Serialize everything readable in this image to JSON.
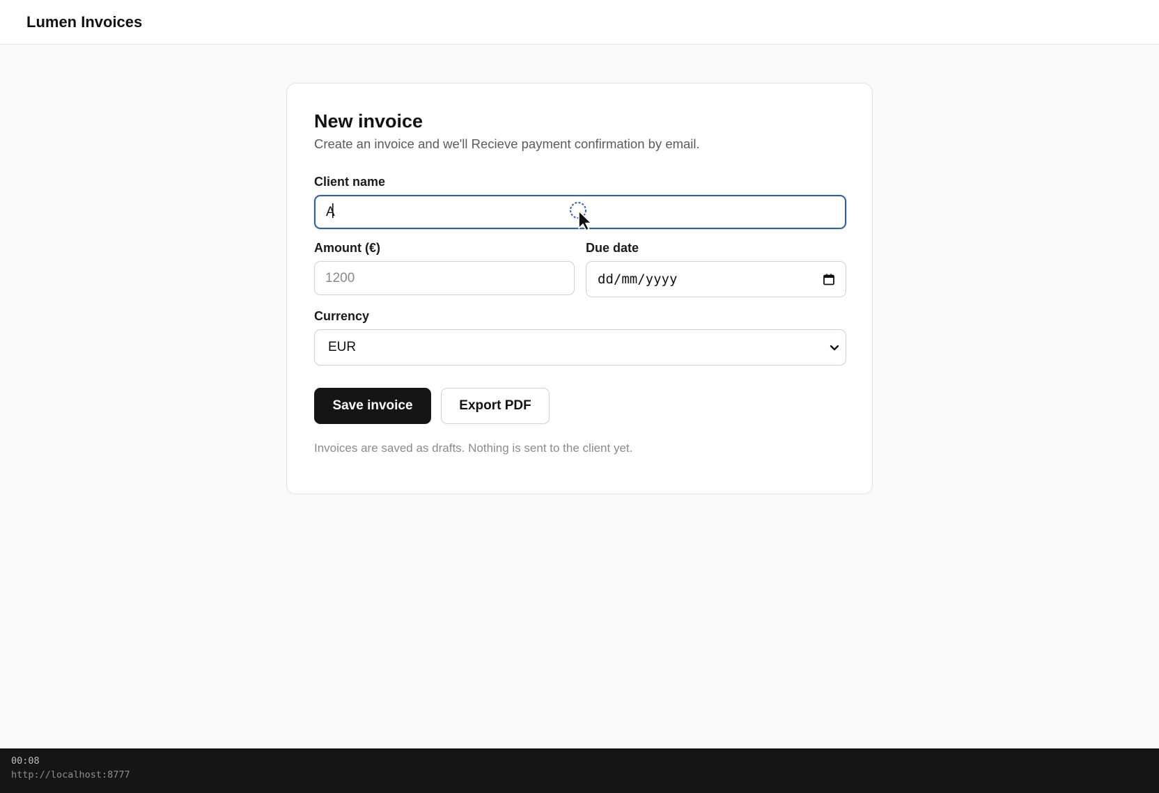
{
  "app": {
    "title": "Lumen Invoices"
  },
  "form": {
    "title": "New invoice",
    "subtitle": "Create an invoice and we'll Recieve payment confirmation by email.",
    "client_name": {
      "label": "Client name",
      "value": "A",
      "focused": true
    },
    "amount": {
      "label": "Amount (€)",
      "value": "",
      "placeholder": "1200"
    },
    "due_date": {
      "label": "Due date",
      "value": "dd/mm/yyyy",
      "icon": "calendar-icon"
    },
    "currency": {
      "label": "Currency",
      "selected": "EUR",
      "icon": "chevron-down-icon"
    },
    "buttons": {
      "save": "Save invoice",
      "export": "Export PDF"
    },
    "footnote": "Invoices are saved as drafts. Nothing is sent to the client yet."
  },
  "status": {
    "timer": "00:08",
    "url": "http://localhost:8777"
  },
  "colors": {
    "accent_focus": "#2d5fa8",
    "primary_button": "#151515",
    "page_background": "#f9f9f9"
  }
}
